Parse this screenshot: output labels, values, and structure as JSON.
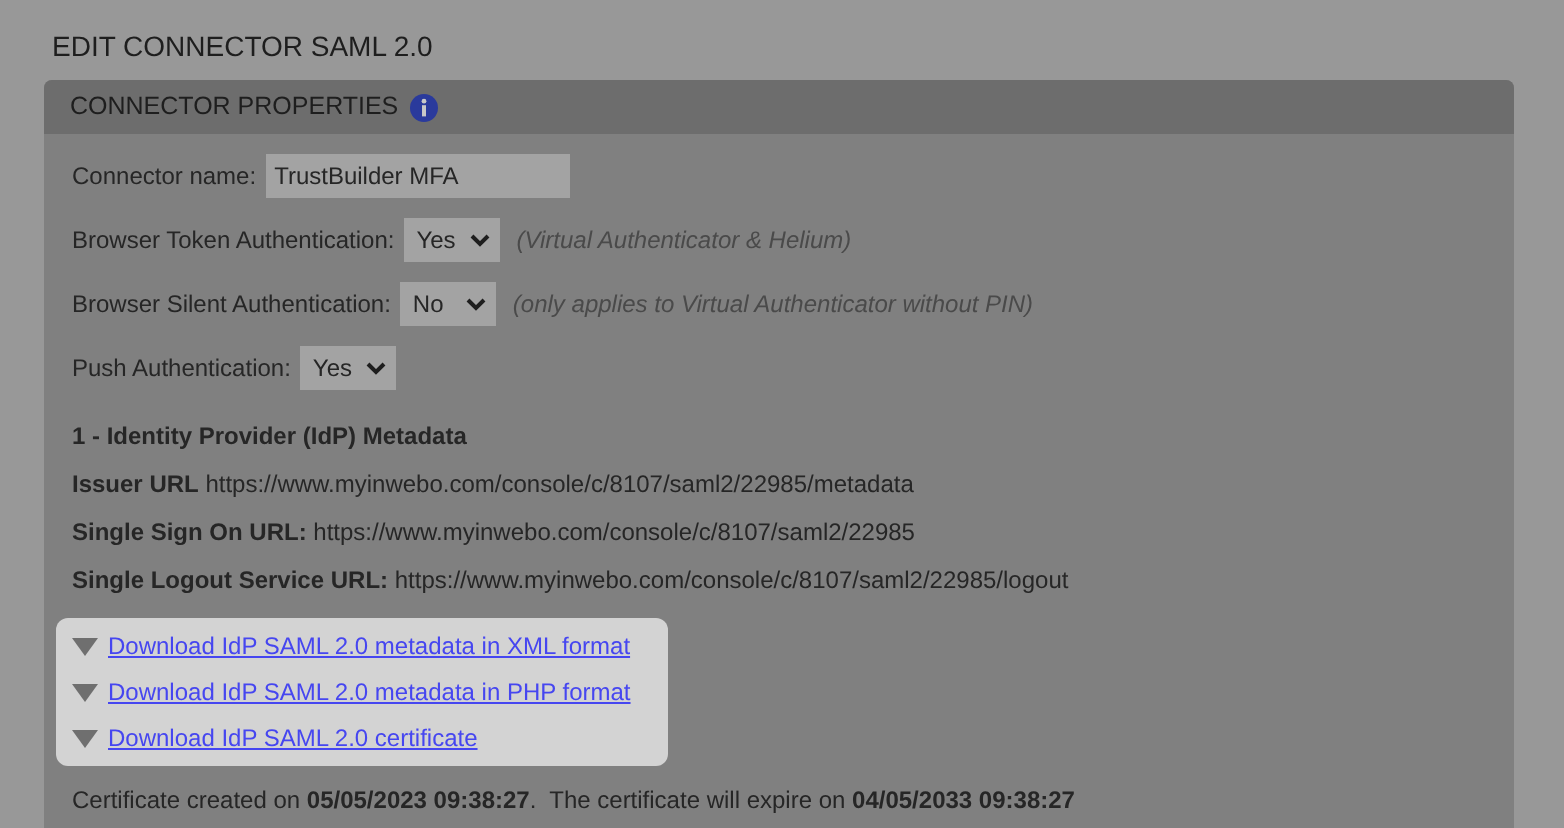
{
  "page_title": "EDIT CONNECTOR SAML 2.0",
  "panel": {
    "title": "CONNECTOR PROPERTIES"
  },
  "fields": [
    {
      "kind": "text",
      "label": "Connector name:",
      "value": "TrustBuilder MFA"
    },
    {
      "kind": "select",
      "label": "Browser Token Authentication:",
      "value": "Yes",
      "note": "(Virtual Authenticator & Helium)"
    },
    {
      "kind": "select",
      "label": "Browser Silent Authentication:",
      "value": "No",
      "note": "(only applies to Virtual Authenticator without PIN)"
    },
    {
      "kind": "select",
      "label": "Push Authentication:",
      "value": "Yes"
    }
  ],
  "metadata": {
    "heading": "1 - Identity Provider (IdP) Metadata",
    "lines": [
      "**Issuer URL** https://www.myinwebo.com/console/c/8107/saml2/22985/metadata",
      "**Single Sign On URL:** https://www.myinwebo.com/console/c/8107/saml2/22985",
      "**Single Logout Service URL:** https://www.myinwebo.com/console/c/8107/saml2/22985/logout"
    ]
  },
  "downloads": [
    {
      "label": "Download IdP SAML 2.0 metadata in XML format"
    },
    {
      "label": "Download IdP SAML 2.0 metadata in PHP format"
    },
    {
      "label": "Download IdP SAML 2.0 certificate"
    }
  ],
  "certificate": "Certificate created on **05/05/2023 09:38:27**.  The certificate will expire on **04/05/2033 09:38:27**"
}
